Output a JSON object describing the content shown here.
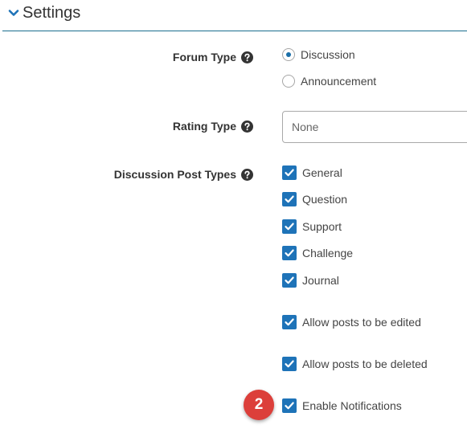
{
  "section": {
    "title": "Settings",
    "chevron_icon": "chevron-down-icon"
  },
  "colors": {
    "accent": "#1e73b8",
    "divider": "#1a6d8f",
    "badge": "#dc3f3a"
  },
  "forum_type": {
    "label": "Forum Type",
    "help_icon": "question-circle-icon",
    "options": [
      {
        "label": "Discussion",
        "selected": true
      },
      {
        "label": "Announcement",
        "selected": false
      }
    ]
  },
  "rating_type": {
    "label": "Rating Type",
    "help_icon": "question-circle-icon",
    "selected_value": "None"
  },
  "post_types": {
    "label": "Discussion Post Types",
    "help_icon": "question-circle-icon",
    "options": [
      {
        "label": "General",
        "checked": true
      },
      {
        "label": "Question",
        "checked": true
      },
      {
        "label": "Support",
        "checked": true
      },
      {
        "label": "Challenge",
        "checked": true
      },
      {
        "label": "Journal",
        "checked": true
      }
    ]
  },
  "allow_edit": {
    "label": "Allow posts to be edited",
    "checked": true
  },
  "allow_delete": {
    "label": "Allow posts to be deleted",
    "checked": true
  },
  "enable_notifications": {
    "label": "Enable Notifications",
    "checked": true
  },
  "step_badge": {
    "number": "2"
  }
}
